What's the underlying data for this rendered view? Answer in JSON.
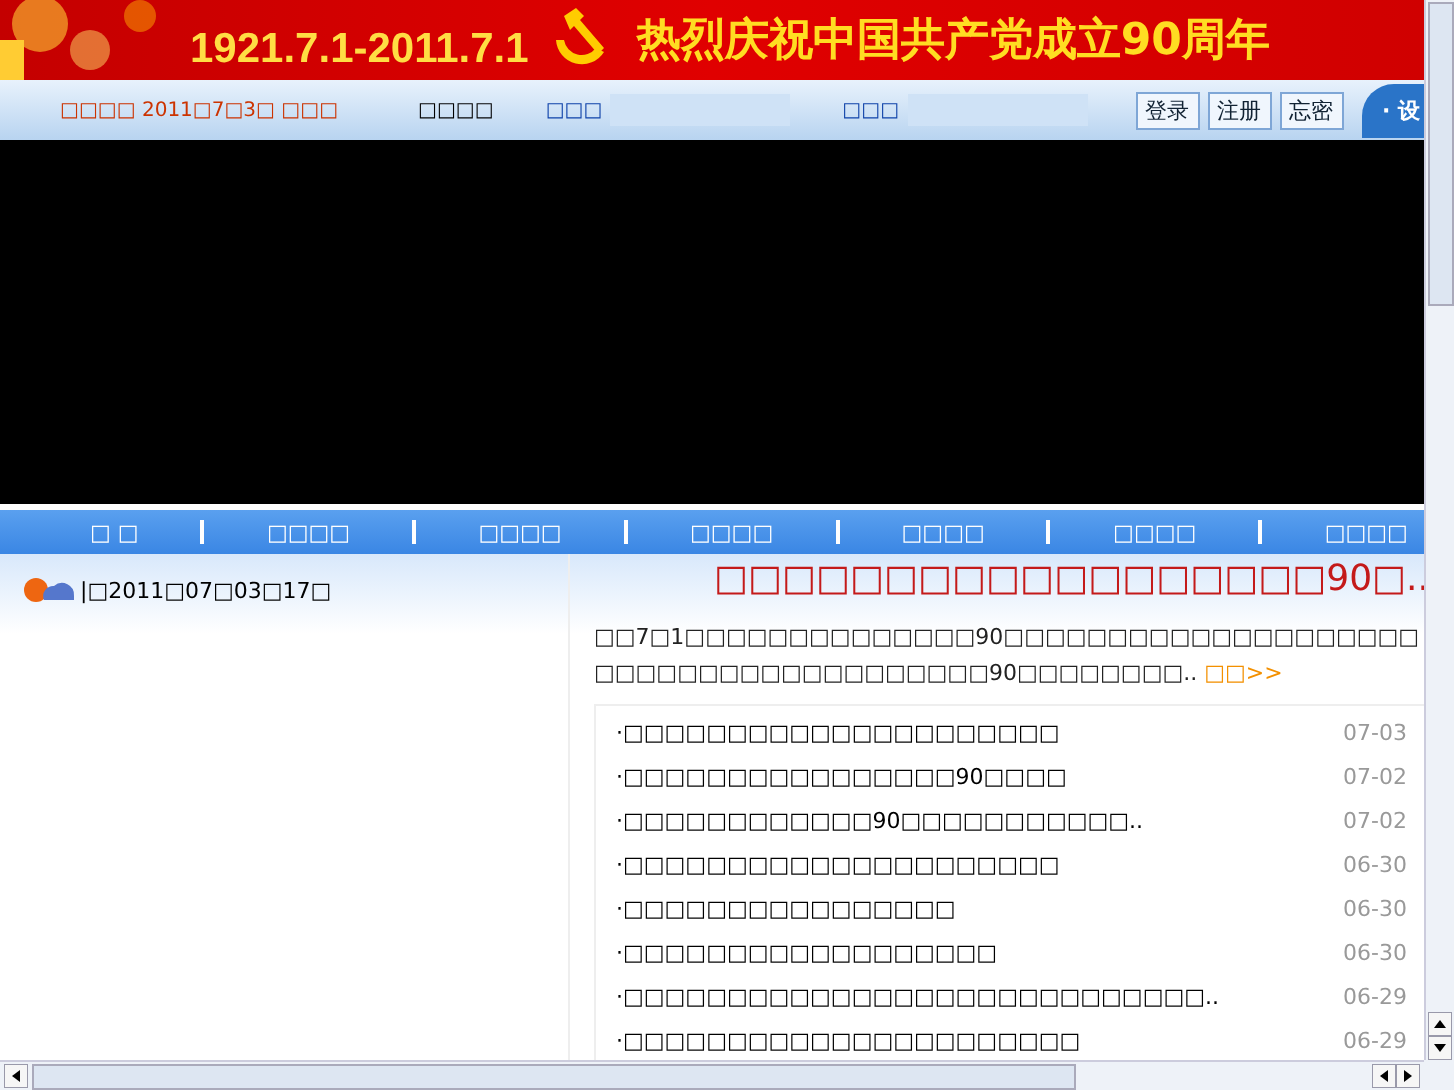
{
  "banner": {
    "dates": "1921.7.1-2011.7.1",
    "title": "热烈庆祝中国共产党成立90周年"
  },
  "top_bar": {
    "date": "□□□□ 2011□7□3□ □□□",
    "greeting": "□□□□",
    "username_label": "□□□",
    "password_label": "□□□",
    "buttons": [
      "登录",
      "注册",
      "忘密"
    ],
    "corner_text": "· 设"
  },
  "nav": [
    "□ □",
    "□□□□",
    "□□□□",
    "□□□□",
    "□□□□",
    "□□□□",
    "□□□□"
  ],
  "weather": {
    "text": "|□2011□07□03□17□"
  },
  "headline": "□□□□□□□□□□□□□□□□□□90□..",
  "summary": {
    "text": "□□7□1□□□□□□□□□□□□□□90□□□□□□□□□□□□□□□□□□□□□□□□□□□□□□□□□□□□□□□90□□□□□□□□..",
    "more": "□□>>"
  },
  "news": [
    {
      "title": "·□□□□□□□□□□□□□□□□□□□□□",
      "date": "07-03"
    },
    {
      "title": "·□□□□□□□□□□□□□□□□90□□□□",
      "date": "07-02"
    },
    {
      "title": "·□□□□□□□□□□□□90□□□□□□□□□□□..",
      "date": "07-02"
    },
    {
      "title": "·□□□□□□□□□□□□□□□□□□□□□",
      "date": "06-30"
    },
    {
      "title": "·□□□□□□□□□□□□□□□□",
      "date": "06-30"
    },
    {
      "title": "·□□□□□□□□□□□□□□□□□□",
      "date": "06-30"
    },
    {
      "title": "·□□□□□□□□□□□□□□□□□□□□□□□□□□□□..",
      "date": "06-29"
    },
    {
      "title": "·□□□□□□□□□□□□□□□□□□□□□□",
      "date": "06-29"
    }
  ]
}
